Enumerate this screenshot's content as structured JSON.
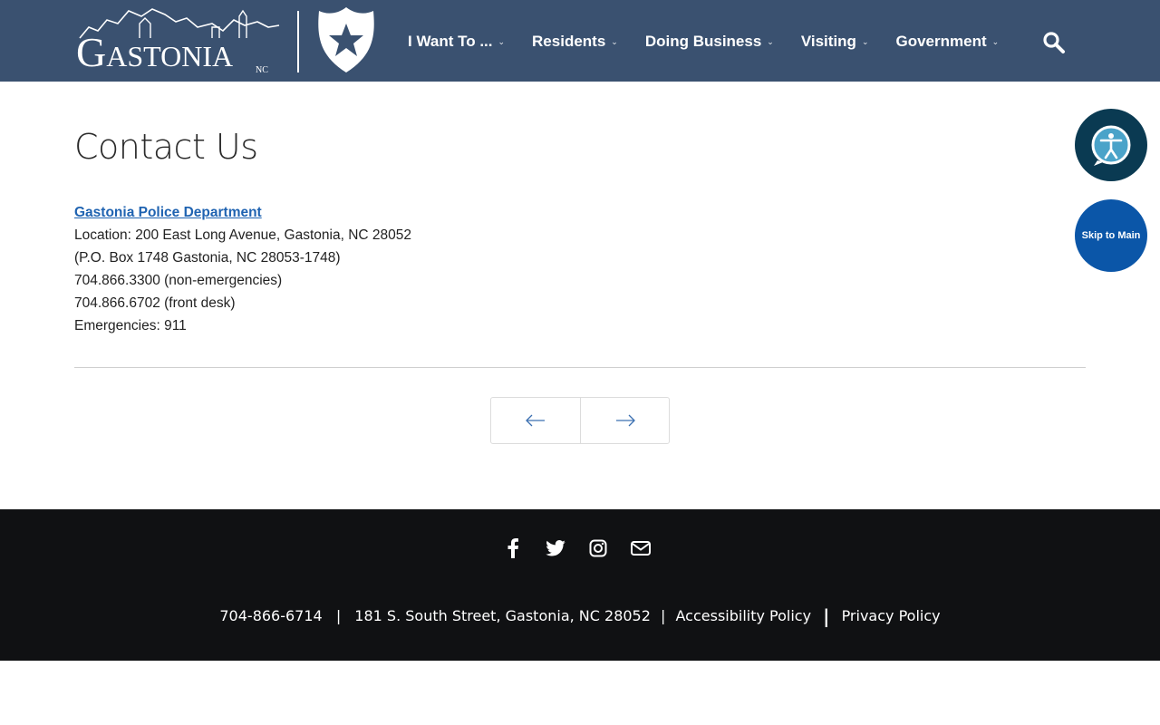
{
  "header": {
    "logo_text": "Gastonia",
    "logo_sub": "NC",
    "nav": [
      {
        "label": "I Want To ..."
      },
      {
        "label": "Residents"
      },
      {
        "label": "Doing Business"
      },
      {
        "label": "Visiting"
      },
      {
        "label": "Government"
      }
    ],
    "search_icon": "search-icon",
    "badge_icon": "police-badge-star-icon"
  },
  "main": {
    "title": "Contact Us",
    "department_link": "Gastonia Police Department",
    "lines": [
      "Location: 200 East Long Avenue, Gastonia, NC 28052",
      "(P.O. Box 1748 Gastonia, NC 28053-1748)",
      "704.866.3300 (non-emergencies)",
      "704.866.6702 (front desk)",
      "Emergencies: 911"
    ]
  },
  "widgets": {
    "skip_label": "Skip to Main",
    "accessibility_icon": "accessibility-icon"
  },
  "footer": {
    "social": [
      "facebook-icon",
      "twitter-icon",
      "instagram-icon",
      "mail-icon"
    ],
    "phone": "704-866-6714",
    "address": "181 S. South Street, Gastonia, NC 28052",
    "accessibility_link": "Accessibility Policy",
    "privacy_link": "Privacy Policy"
  },
  "colors": {
    "header_bg": "#3a5170",
    "link": "#1f63b1",
    "footer_bg": "#101113",
    "skip_bg": "#0b56a8",
    "a11y_bg": "#0a3a52"
  }
}
